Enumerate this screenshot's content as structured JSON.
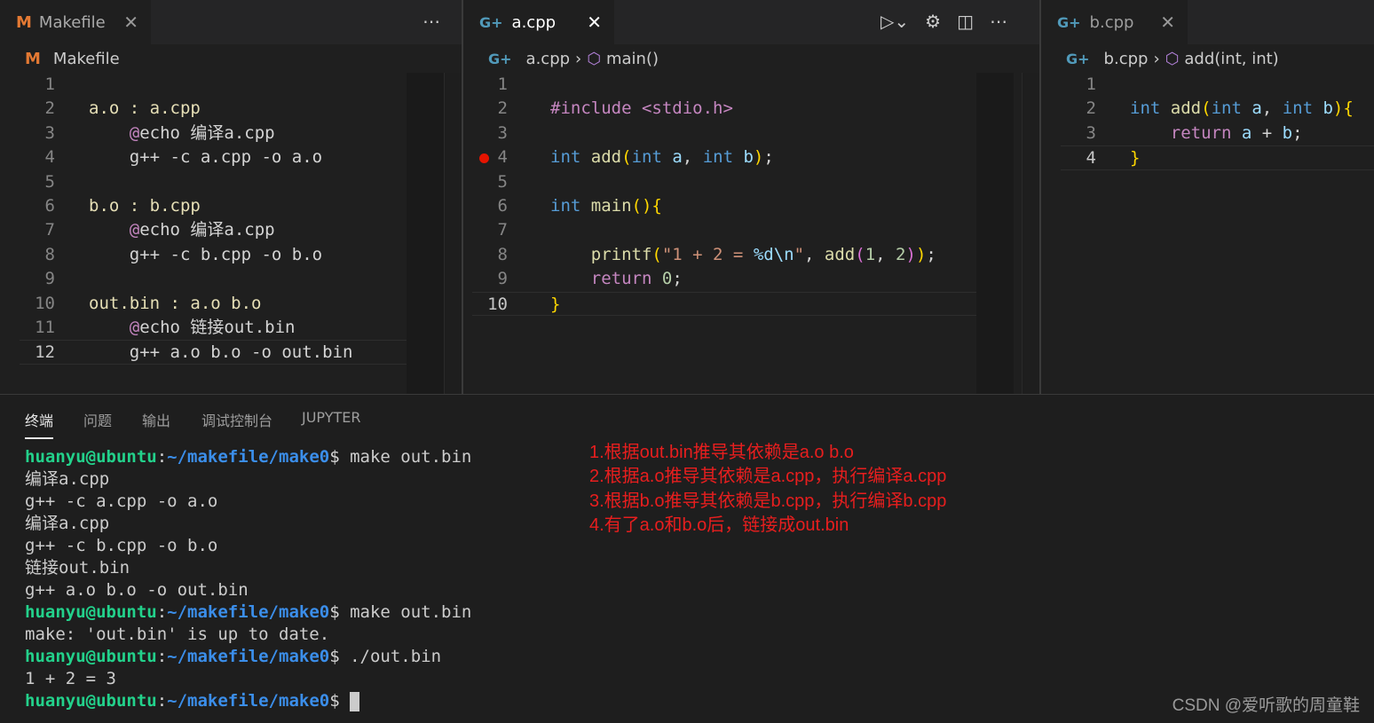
{
  "panes": [
    {
      "tab": {
        "label": "Makefile",
        "icon": "makefile-icon"
      },
      "breadcrumb": [
        "Makefile"
      ],
      "lines": [
        [],
        [
          [
            "a.o : a.cpp",
            "tg"
          ]
        ],
        [
          [
            "    ",
            "df"
          ],
          [
            "@",
            "ctl"
          ],
          [
            "echo 编译a.cpp",
            "df"
          ]
        ],
        [
          [
            "    g++ -c a.cpp -o a.o",
            "df"
          ]
        ],
        [],
        [
          [
            "b.o : b.cpp",
            "tg"
          ]
        ],
        [
          [
            "    ",
            "df"
          ],
          [
            "@",
            "ctl"
          ],
          [
            "echo 编译a.cpp",
            "df"
          ]
        ],
        [
          [
            "    g++ -c b.cpp -o b.o",
            "df"
          ]
        ],
        [],
        [
          [
            "out.bin : a.o b.o",
            "tg"
          ]
        ],
        [
          [
            "    ",
            "df"
          ],
          [
            "@",
            "ctl"
          ],
          [
            "echo 链接out.bin",
            "df"
          ]
        ],
        [
          [
            "    g++ a.o b.o -o out.bin",
            "df"
          ]
        ]
      ],
      "current_line": 12
    },
    {
      "tab": {
        "label": "a.cpp",
        "icon": "cpp-icon"
      },
      "breadcrumb": [
        "a.cpp",
        "main()"
      ],
      "lines": [
        [],
        [
          [
            "#include <stdio.h>",
            "pp"
          ]
        ],
        [],
        [
          [
            "int",
            "kw"
          ],
          [
            " ",
            "df"
          ],
          [
            "add",
            "fn"
          ],
          [
            "(",
            "b1"
          ],
          [
            "int",
            "kw"
          ],
          [
            " ",
            "df"
          ],
          [
            "a",
            "pa"
          ],
          [
            ", ",
            "df"
          ],
          [
            "int",
            "kw"
          ],
          [
            " ",
            "df"
          ],
          [
            "b",
            "pa"
          ],
          [
            ")",
            "b1"
          ],
          [
            ";",
            "df"
          ]
        ],
        [],
        [
          [
            "int",
            "kw"
          ],
          [
            " ",
            "df"
          ],
          [
            "main",
            "fn"
          ],
          [
            "(){",
            "b1"
          ]
        ],
        [],
        [
          [
            "    ",
            "df"
          ],
          [
            "printf",
            "fn"
          ],
          [
            "(",
            "b1"
          ],
          [
            "\"1 + 2 = ",
            "st"
          ],
          [
            "%d\\n",
            "pa"
          ],
          [
            "\"",
            "st"
          ],
          [
            ", ",
            "df"
          ],
          [
            "add",
            "fn"
          ],
          [
            "(",
            "b2"
          ],
          [
            "1",
            "nu"
          ],
          [
            ", ",
            "df"
          ],
          [
            "2",
            "nu"
          ],
          [
            ")",
            "b2"
          ],
          [
            ")",
            "b1"
          ],
          [
            ";",
            "df"
          ]
        ],
        [
          [
            "    ",
            "df"
          ],
          [
            "return",
            "ctl"
          ],
          [
            " ",
            "df"
          ],
          [
            "0",
            "nu"
          ],
          [
            ";",
            "df"
          ]
        ],
        [
          [
            "}",
            "b1"
          ]
        ]
      ],
      "current_line": 10,
      "breakpoint_line": 4
    },
    {
      "tab": {
        "label": "b.cpp",
        "icon": "cpp-icon"
      },
      "breadcrumb": [
        "b.cpp",
        "add(int, int)"
      ],
      "lines": [
        [],
        [
          [
            "int",
            "kw"
          ],
          [
            " ",
            "df"
          ],
          [
            "add",
            "fn"
          ],
          [
            "(",
            "b1"
          ],
          [
            "int",
            "kw"
          ],
          [
            " ",
            "df"
          ],
          [
            "a",
            "pa"
          ],
          [
            ", ",
            "df"
          ],
          [
            "int",
            "kw"
          ],
          [
            " ",
            "df"
          ],
          [
            "b",
            "pa"
          ],
          [
            ")",
            "b1"
          ],
          [
            "{",
            "b1"
          ]
        ],
        [
          [
            "    ",
            "df"
          ],
          [
            "return",
            "ctl"
          ],
          [
            " ",
            "df"
          ],
          [
            "a",
            "pa"
          ],
          [
            " + ",
            "df"
          ],
          [
            "b",
            "pa"
          ],
          [
            ";",
            "df"
          ]
        ],
        [
          [
            "}",
            "b1"
          ]
        ]
      ],
      "current_line": 4
    }
  ],
  "panel": {
    "tabs": [
      "终端",
      "问题",
      "输出",
      "调试控制台",
      "JUPYTER"
    ],
    "active_tab": "终端"
  },
  "terminal": {
    "prompt_user": "huanyu@ubuntu",
    "prompt_path": "~/makefile/make0",
    "prompt_sym": "$",
    "lines": [
      {
        "prompt": true,
        "text": " make out.bin"
      },
      {
        "text": "编译a.cpp"
      },
      {
        "text": "g++ -c a.cpp -o a.o"
      },
      {
        "text": "编译a.cpp"
      },
      {
        "text": "g++ -c b.cpp -o b.o"
      },
      {
        "text": "链接out.bin"
      },
      {
        "text": "g++ a.o b.o -o out.bin"
      },
      {
        "prompt": true,
        "text": " make out.bin"
      },
      {
        "text": "make: 'out.bin' is up to date."
      },
      {
        "prompt": true,
        "text": " ./out.bin"
      },
      {
        "text": "1 + 2 = 3"
      },
      {
        "prompt": true,
        "text": " ",
        "cursor": true
      }
    ]
  },
  "annotations": [
    "1.根据out.bin推导其依赖是a.o b.o",
    "2.根据a.o推导其依赖是a.cpp，执行编译a.cpp",
    "3.根据b.o推导其依赖是b.cpp，执行编译b.cpp",
    "4.有了a.o和b.o后，链接成out.bin"
  ],
  "watermark": "CSDN @爱听歌的周童鞋",
  "colors": {
    "annotation": "#e81e1e",
    "prompt_user": "#23d18b",
    "prompt_path": "#3b8eea",
    "breakpoint": "#e51400"
  }
}
